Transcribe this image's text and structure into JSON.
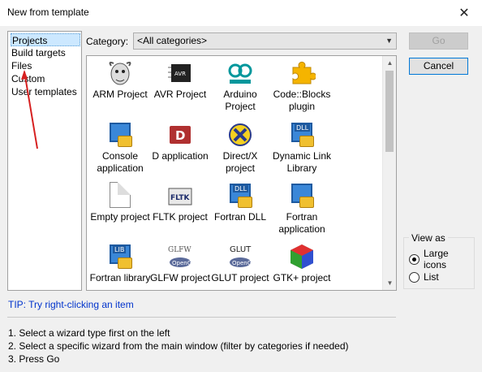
{
  "window": {
    "title": "New from template",
    "close_icon": "close-icon"
  },
  "left_list": {
    "items": [
      {
        "label": "Projects",
        "selected": true
      },
      {
        "label": "Build targets",
        "selected": false
      },
      {
        "label": "Files",
        "selected": false
      },
      {
        "label": "Custom",
        "selected": false
      },
      {
        "label": "User templates",
        "selected": false
      }
    ]
  },
  "category": {
    "label": "Category:",
    "value": "<All categories>"
  },
  "templates": [
    {
      "label": "ARM Project",
      "icon": "gnu-icon"
    },
    {
      "label": "AVR Project",
      "icon": "avr-chip-icon"
    },
    {
      "label": "Arduino Project",
      "icon": "arduino-icon"
    },
    {
      "label": "Code::Blocks plugin",
      "icon": "puzzle-icon"
    },
    {
      "label": "Console application",
      "icon": "console-app-icon"
    },
    {
      "label": "D application",
      "icon": "d-app-icon"
    },
    {
      "label": "Direct/X project",
      "icon": "directx-icon"
    },
    {
      "label": "Dynamic Link Library",
      "icon": "dll-icon"
    },
    {
      "label": "Empty project",
      "icon": "blank-document-icon"
    },
    {
      "label": "FLTK project",
      "icon": "fltk-icon"
    },
    {
      "label": "Fortran DLL",
      "icon": "fortran-dll-icon"
    },
    {
      "label": "Fortran application",
      "icon": "fortran-app-icon"
    },
    {
      "label": "Fortran library",
      "icon": "fortran-lib-icon"
    },
    {
      "label": "GLFW project",
      "icon": "glfw-icon"
    },
    {
      "label": "GLUT project",
      "icon": "glut-icon"
    },
    {
      "label": "GTK+ project",
      "icon": "gtk-icon"
    }
  ],
  "buttons": {
    "go": "Go",
    "cancel": "Cancel"
  },
  "view_as": {
    "title": "View as",
    "options": [
      {
        "label": "Large icons",
        "selected": true
      },
      {
        "label": "List",
        "selected": false
      }
    ]
  },
  "tip": "TIP: Try right-clicking an item",
  "steps": [
    "1. Select a wizard type first on the left",
    "2. Select a specific wizard from the main window (filter by categories if needed)",
    "3. Press Go"
  ],
  "colors": {
    "tip": "#0033cc",
    "selection": "#cce8ff",
    "annotation_arrow": "#d62020"
  }
}
